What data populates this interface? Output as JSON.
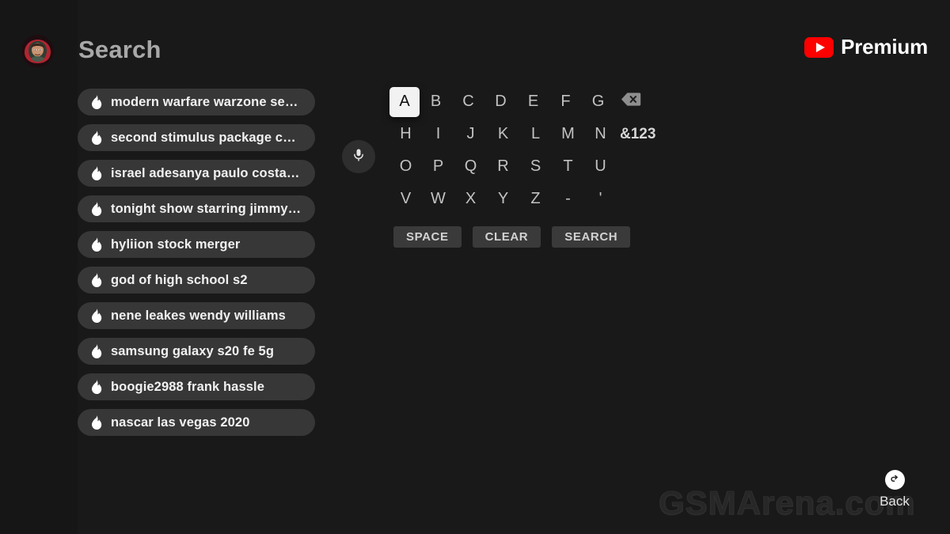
{
  "app": {
    "background_color": "#191919",
    "rail_color": "#161616",
    "accent_color": "#ff0000",
    "chip_color": "#373737"
  },
  "header": {
    "title": "Search",
    "avatar_name": "avatar",
    "brand": {
      "logo_name": "youtube-logo-icon",
      "label": "Premium"
    }
  },
  "sidebar": {
    "items": [
      {
        "icon": "search-icon",
        "name": "sidebar-item-search"
      },
      {
        "icon": "home-icon",
        "name": "sidebar-item-home"
      },
      {
        "icon": "subscriptions-icon",
        "name": "sidebar-item-subscriptions"
      },
      {
        "icon": "live-icon",
        "name": "sidebar-item-live"
      },
      {
        "icon": "gaming-icon",
        "name": "sidebar-item-gaming"
      },
      {
        "icon": "movies-icon",
        "name": "sidebar-item-movies"
      },
      {
        "icon": "library-icon",
        "name": "sidebar-item-library"
      },
      {
        "icon": "playlist-icon",
        "name": "sidebar-item-playlist"
      }
    ],
    "settings": {
      "icon": "gear-icon",
      "name": "sidebar-item-settings"
    }
  },
  "suggestions": {
    "icon": "trending-flame-icon",
    "items": [
      {
        "label": "modern warfare warzone se…"
      },
      {
        "label": "second stimulus package c…"
      },
      {
        "label": "israel adesanya paulo costa…"
      },
      {
        "label": "tonight show starring jimmy…"
      },
      {
        "label": "hyliion stock merger"
      },
      {
        "label": "god of high school s2"
      },
      {
        "label": "nene leakes wendy williams"
      },
      {
        "label": "samsung galaxy s20 fe 5g"
      },
      {
        "label": "boogie2988 frank hassle"
      },
      {
        "label": "nascar las vegas 2020"
      }
    ]
  },
  "voice": {
    "icon": "microphone-icon",
    "name": "voice-search-button"
  },
  "keyboard": {
    "selected_key": "A",
    "rows": [
      [
        "A",
        "B",
        "C",
        "D",
        "E",
        "F",
        "G",
        "BACKSPACE"
      ],
      [
        "H",
        "I",
        "J",
        "K",
        "L",
        "M",
        "N",
        "&123"
      ],
      [
        "O",
        "P",
        "Q",
        "R",
        "S",
        "T",
        "U"
      ],
      [
        "V",
        "W",
        "X",
        "Y",
        "Z",
        "-",
        "'"
      ]
    ],
    "backspace_icon": "backspace-icon",
    "symbols_label": "&123",
    "actions": [
      {
        "label": "SPACE",
        "name": "space-button"
      },
      {
        "label": "CLEAR",
        "name": "clear-button"
      },
      {
        "label": "SEARCH",
        "name": "search-button"
      }
    ]
  },
  "watermark": {
    "text": "GSMArena.com"
  },
  "back": {
    "label": "Back",
    "icon": "back-arrow-icon"
  }
}
